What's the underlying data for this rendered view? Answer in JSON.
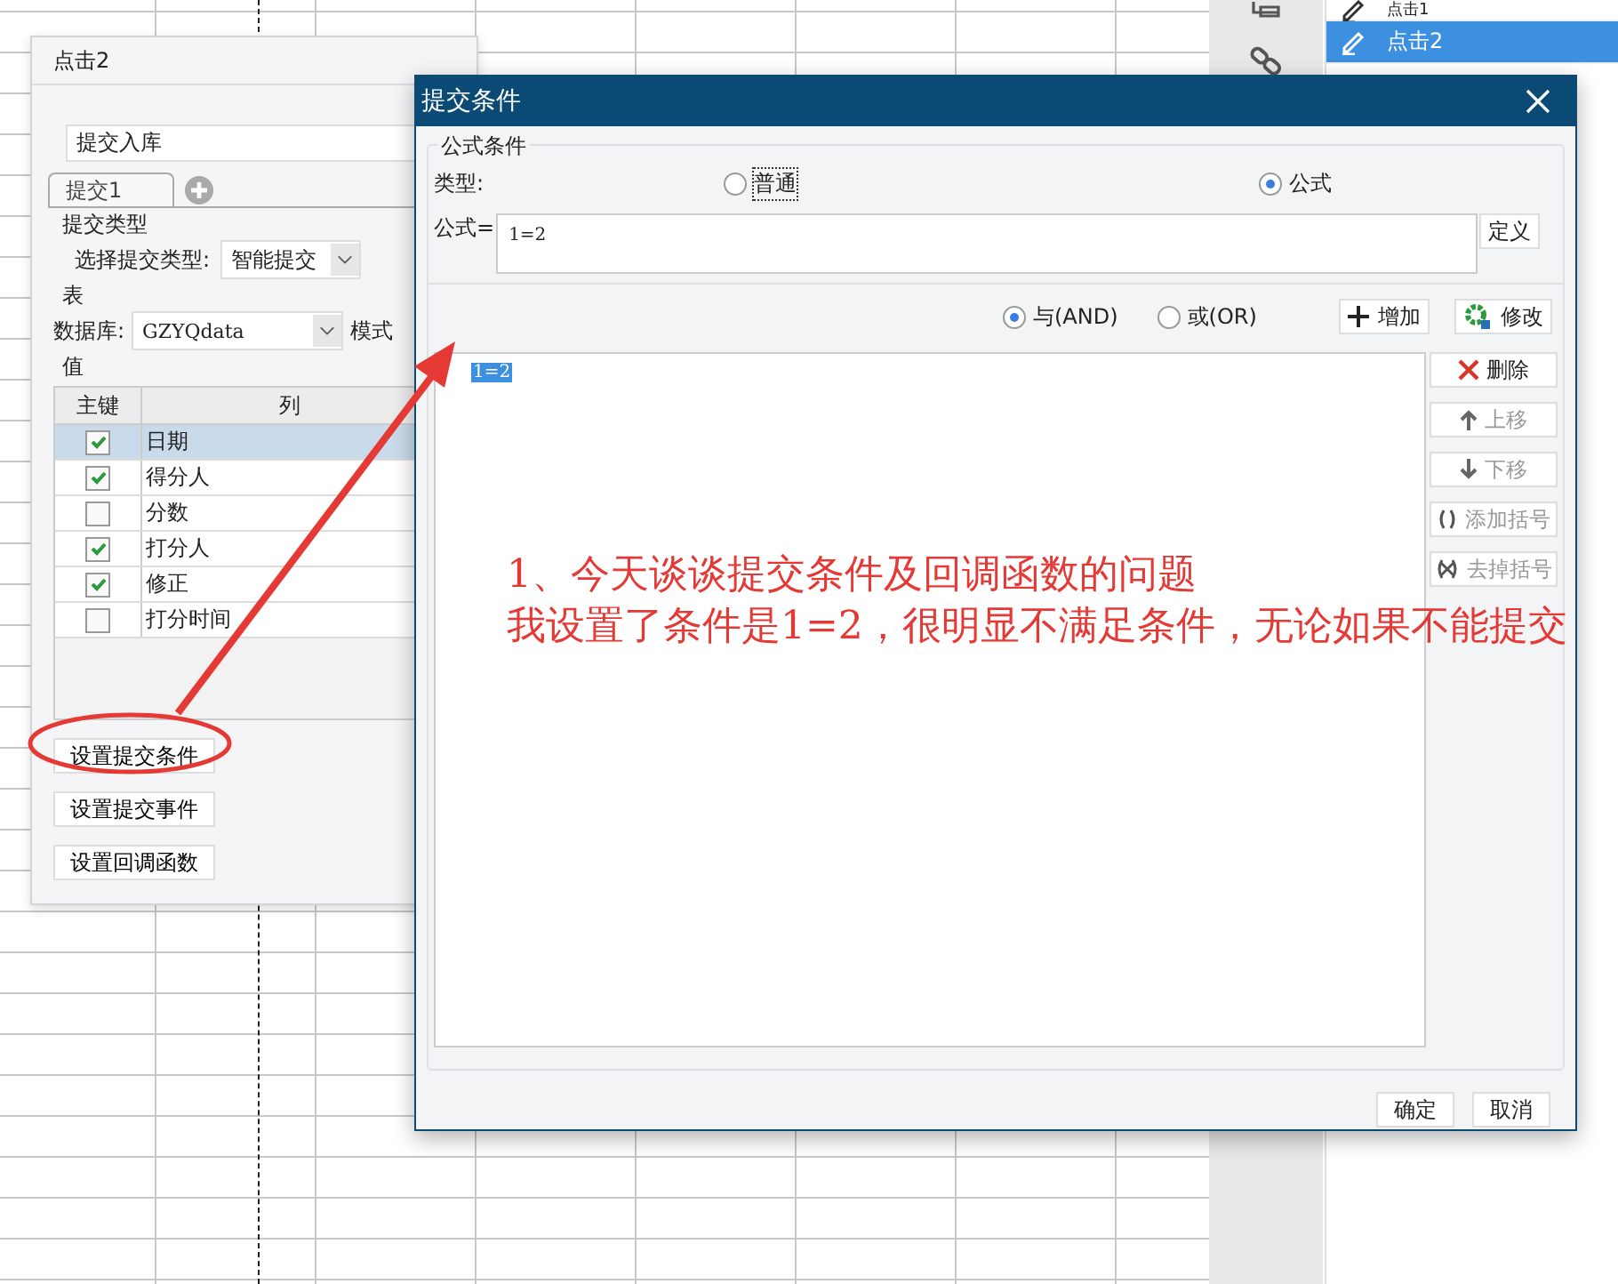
{
  "side_list": {
    "items": [
      {
        "label": "点击1",
        "selected": false
      },
      {
        "label": "点击2",
        "selected": true
      }
    ]
  },
  "panel": {
    "title": "点击2",
    "name_value": "提交入库",
    "tabs": [
      {
        "label": "提交1",
        "selected": true
      }
    ],
    "submit_type_section": "提交类型",
    "submit_type_label": "选择提交类型:",
    "submit_type_value": "智能提交",
    "table_section": "表",
    "database_label": "数据库:",
    "database_value": "GZYQdata",
    "mode_label": "模式",
    "values_section": "值",
    "columns": [
      "主键",
      "列"
    ],
    "rows": [
      {
        "checked": true,
        "label": "日期",
        "selected": true
      },
      {
        "checked": true,
        "label": "得分人",
        "selected": false
      },
      {
        "checked": false,
        "label": "分数",
        "selected": false
      },
      {
        "checked": true,
        "label": "打分人",
        "selected": false
      },
      {
        "checked": true,
        "label": "修正",
        "selected": false
      },
      {
        "checked": false,
        "label": "打分时间",
        "selected": false
      }
    ],
    "buttons": [
      "设置提交条件",
      "设置提交事件",
      "设置回调函数"
    ]
  },
  "dialog": {
    "title": "提交条件",
    "group_title": "公式条件",
    "type_label": "类型:",
    "type_options": [
      {
        "label": "普通",
        "selected": false
      },
      {
        "label": "公式",
        "selected": true
      }
    ],
    "formula_label": "公式=",
    "formula_value": "1=2",
    "define_button": "定义",
    "logic_options": [
      {
        "label": "与(AND)",
        "selected": true
      },
      {
        "label": "或(OR)",
        "selected": false
      }
    ],
    "actions": [
      {
        "label": "增加",
        "kind": "add"
      },
      {
        "label": "修改",
        "kind": "edit"
      }
    ],
    "conditions": [
      {
        "text": "1=2",
        "selected": true
      }
    ],
    "side_buttons": [
      {
        "label": "删除",
        "kind": "delete",
        "disabled": false
      },
      {
        "label": "上移",
        "kind": "up",
        "disabled": true
      },
      {
        "label": "下移",
        "kind": "down",
        "disabled": true
      },
      {
        "label": "添加括号",
        "kind": "add-bracket",
        "disabled": true
      },
      {
        "label": "去掉括号",
        "kind": "remove-bracket",
        "disabled": true
      }
    ],
    "footer_buttons": [
      "确定",
      "取消"
    ]
  },
  "annotation": {
    "lines": [
      "1、今天谈谈提交条件及回调函数的问题",
      "我设置了条件是1=2，很明显不满足条件，无论如果不能提交"
    ]
  }
}
